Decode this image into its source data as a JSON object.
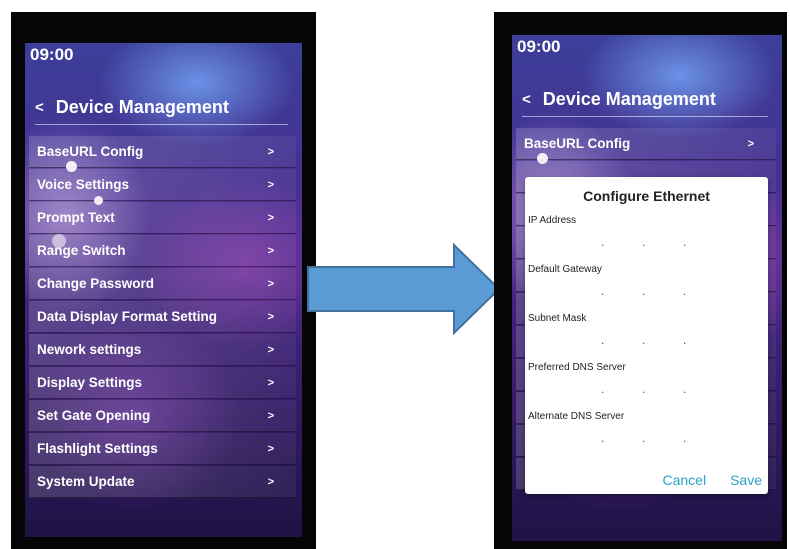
{
  "left_screen": {
    "time": "09:00",
    "title": "Device Management",
    "back_icon": "<",
    "chevron": ">",
    "menu": [
      {
        "label": "BaseURL Config"
      },
      {
        "label": "Voice Settings"
      },
      {
        "label": "Prompt Text"
      },
      {
        "label": "Range Switch"
      },
      {
        "label": "Change Password"
      },
      {
        "label": "Data Display Format Setting"
      },
      {
        "label": "Nework settings"
      },
      {
        "label": "Display Settings"
      },
      {
        "label": "Set Gate Opening"
      },
      {
        "label": "Flashlight Settings"
      },
      {
        "label": "System Update"
      }
    ]
  },
  "right_screen": {
    "time": "09:00",
    "title": "Device Management",
    "back_icon": "<",
    "chevron": ">",
    "first_item": "BaseURL Config",
    "dialog": {
      "title": "Configure Ethernet",
      "fields": [
        {
          "label": "IP Address"
        },
        {
          "label": "Default Gateway"
        },
        {
          "label": "Subnet Mask"
        },
        {
          "label": "Preferred DNS Server"
        },
        {
          "label": "Alternate DNS Server"
        }
      ],
      "cancel_label": "Cancel",
      "save_label": "Save"
    }
  },
  "arrow_color": "#5b9bd5",
  "accent_color": "#2aa3c8"
}
